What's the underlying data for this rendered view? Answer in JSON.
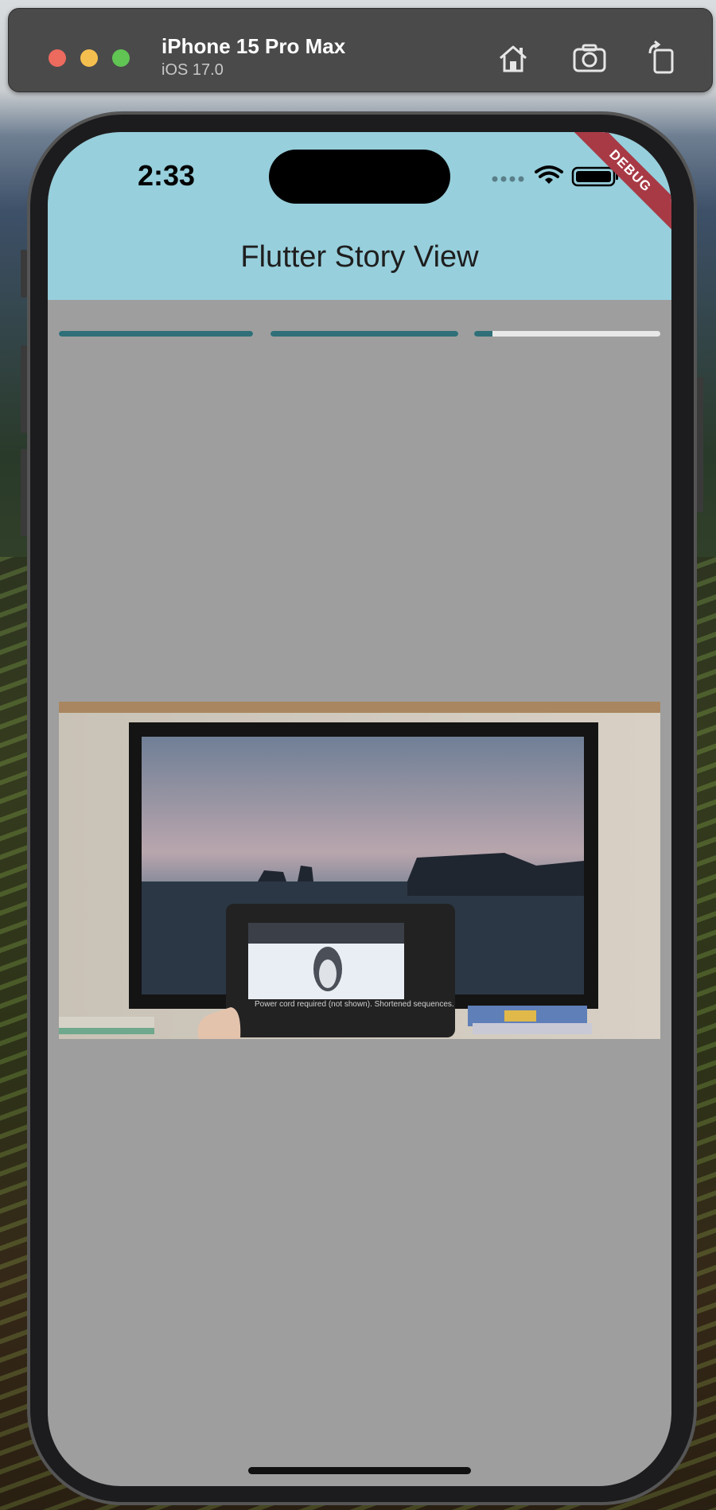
{
  "simulator": {
    "device_name": "iPhone 15 Pro Max",
    "os_version": "iOS 17.0",
    "toolbar_icons": [
      "home-icon",
      "screenshot-camera-icon",
      "rotate-icon"
    ]
  },
  "status_bar": {
    "time": "2:33",
    "icons": [
      "cellular-signal-icon",
      "wifi-icon",
      "battery-icon"
    ]
  },
  "app": {
    "title": "Flutter Story View",
    "debug_banner": "DEBUG",
    "appbar_color": "#97cfdc",
    "background_color": "#9e9e9e"
  },
  "story": {
    "progress_indicators": [
      {
        "name": "story-1",
        "fill": 1.0
      },
      {
        "name": "story-2",
        "fill": 1.0
      },
      {
        "name": "story-3",
        "fill": 0.1
      }
    ],
    "progress_color": "#2e6f78",
    "track_color": "#e8e8e8",
    "media": {
      "type": "video-frame",
      "caption_text": "Power cord required (not shown). Shortened sequences."
    }
  }
}
